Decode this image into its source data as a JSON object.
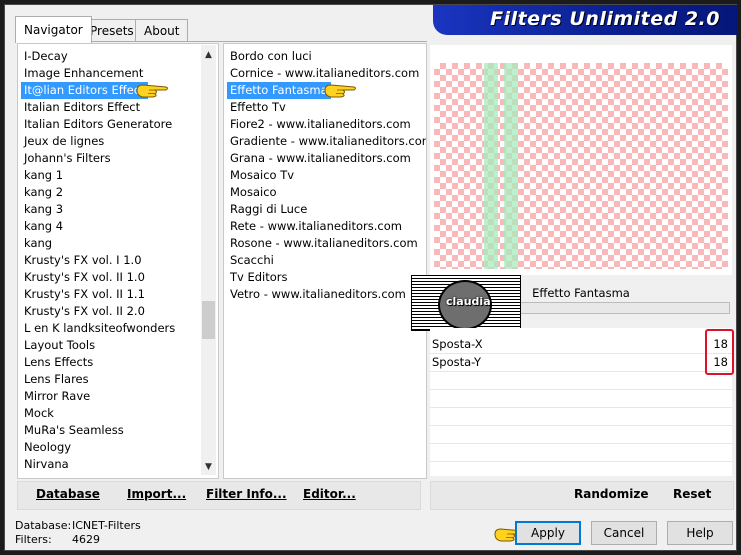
{
  "tabs": [
    "Navigator",
    "Presets",
    "About"
  ],
  "banner_title": "Filters Unlimited 2.0",
  "categories": [
    "I-Decay",
    "Image Enhancement",
    "It@lian Editors Effect",
    "Italian Editors Effect",
    "Italian Editors Generatore",
    "Jeux de lignes",
    "Johann's Filters",
    "kang 1",
    "kang 2",
    "kang 3",
    "kang 4",
    "kang",
    "Krusty's FX vol. I 1.0",
    "Krusty's FX vol. II 1.0",
    "Krusty's FX vol. II 1.1",
    "Krusty's FX vol. II 2.0",
    "L en K landksiteofwonders",
    "Layout Tools",
    "Lens Effects",
    "Lens Flares",
    "Mirror Rave",
    "Mock",
    "MuRa's Seamless",
    "Neology",
    "Nirvana"
  ],
  "filters": [
    "Bordo con luci",
    "Cornice - www.italianeditors.com",
    "Effetto Fantasma",
    "Effetto Tv",
    "Fiore2 - www.italianeditors.com",
    "Gradiente - www.italianeditors.com",
    "Grana - www.italianeditors.com",
    "Mosaico Tv",
    "Mosaico",
    "Raggi di Luce",
    "Rete - www.italianeditors.com",
    "Rosone - www.italianeditors.com",
    "Scacchi",
    "Tv Editors",
    "Vetro - www.italianeditors.com"
  ],
  "selected_category_index": 2,
  "selected_filter_index": 2,
  "filter_name": "Effetto Fantasma",
  "logo_text": "claudia",
  "params": [
    {
      "label": "Sposta-X",
      "value": "18"
    },
    {
      "label": "Sposta-Y",
      "value": "18"
    }
  ],
  "left_buttons": [
    "Database",
    "Import...",
    "Filter Info...",
    "Editor..."
  ],
  "right_buttons": [
    "Randomize",
    "Reset"
  ],
  "status": {
    "database_label": "Database:",
    "database_value": "ICNET-Filters",
    "filters_label": "Filters:",
    "filters_value": "4629"
  },
  "dialog_buttons": {
    "apply": "Apply",
    "cancel": "Cancel",
    "help": "Help"
  },
  "colors": {
    "selection": "#3399ff",
    "banner": "#0a1f8f",
    "highlight_box": "#e0102a",
    "checker": "#f7b9b9",
    "ghost": "#aaebbe"
  }
}
